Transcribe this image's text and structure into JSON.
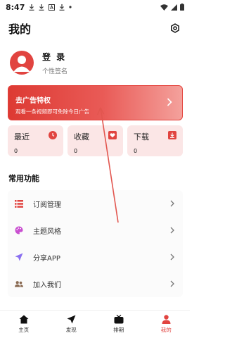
{
  "status_bar": {
    "time": "8:47",
    "icons": [
      "download-icon",
      "download-icon",
      "text-icon",
      "download-icon",
      "dot-icon"
    ],
    "right_icons": [
      "wifi-icon",
      "signal-icon",
      "battery-icon"
    ]
  },
  "header": {
    "title": "我的",
    "settings_icon": "settings-icon"
  },
  "profile": {
    "name": "登 录",
    "signature": "个性签名"
  },
  "ad": {
    "title": "去广告特权",
    "subtitle": "观看一条视频即可免除今日广告"
  },
  "stats": [
    {
      "label": "最近",
      "value": "0",
      "icon": "clock-icon"
    },
    {
      "label": "收藏",
      "value": "0",
      "icon": "heart-icon"
    },
    {
      "label": "下载",
      "value": "0",
      "icon": "download-icon"
    }
  ],
  "common_title": "常用功能",
  "menu": [
    {
      "label": "订阅管理",
      "icon": "list-icon"
    },
    {
      "label": "主题风格",
      "icon": "palette-icon"
    },
    {
      "label": "分享APP",
      "icon": "send-icon"
    },
    {
      "label": "加入我们",
      "icon": "people-icon"
    }
  ],
  "nav": [
    {
      "label": "主页",
      "icon": "home-icon",
      "active": false
    },
    {
      "label": "发现",
      "icon": "navigation-icon",
      "active": false
    },
    {
      "label": "排期",
      "icon": "tv-icon",
      "active": false
    },
    {
      "label": "我的",
      "icon": "user-icon",
      "active": true
    }
  ],
  "colors": {
    "accent": "#e14440",
    "stat_bg": "#fbe6e6",
    "menu_bg": "#fbfbfb"
  }
}
